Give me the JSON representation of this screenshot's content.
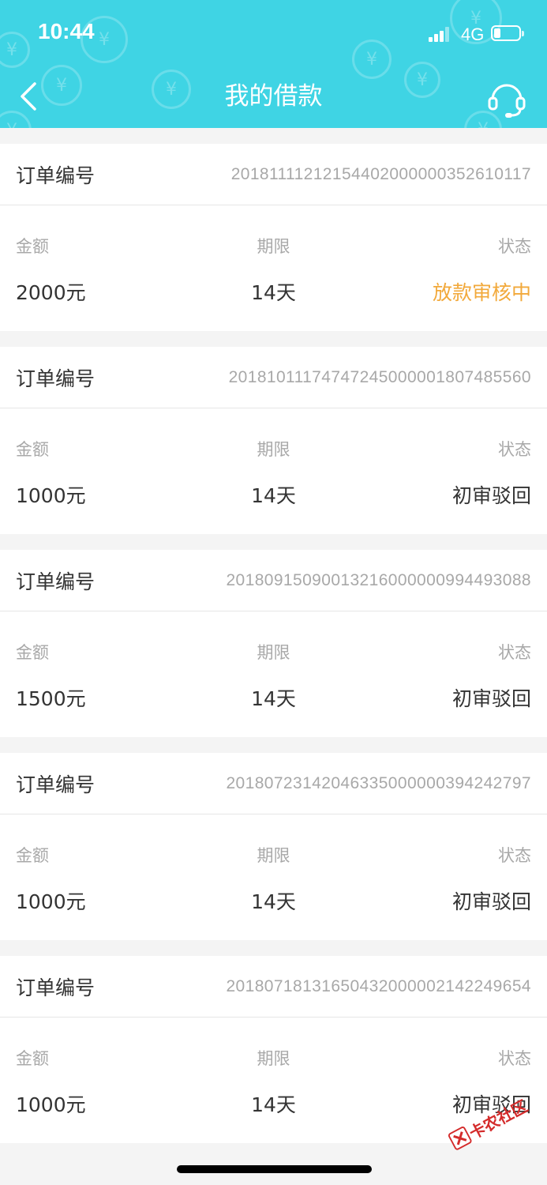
{
  "status_bar": {
    "time": "10:44",
    "network": "4G",
    "battery_level": 0.25
  },
  "nav": {
    "title": "我的借款",
    "back_icon": "chevron-left-icon",
    "support_icon": "headset-icon"
  },
  "colors": {
    "header": "#3fd4e4",
    "status_pending": "#f2a93b",
    "text_primary": "#333333",
    "text_secondary": "#a8a8a8"
  },
  "labels": {
    "order_no": "订单编号",
    "amount": "金额",
    "term": "期限",
    "status": "状态"
  },
  "orders": [
    {
      "order_no": "20181111212154402000000352610117",
      "amount": "2000元",
      "term": "14天",
      "status": "放款审核中",
      "status_type": "pending"
    },
    {
      "order_no": "20181011174747245000001807485560",
      "amount": "1000元",
      "term": "14天",
      "status": "初审驳回",
      "status_type": "rejected"
    },
    {
      "order_no": "20180915090013216000000994493088",
      "amount": "1500元",
      "term": "14天",
      "status": "初审驳回",
      "status_type": "rejected"
    },
    {
      "order_no": "20180723142046335000000394242797",
      "amount": "1000元",
      "term": "14天",
      "status": "初审驳回",
      "status_type": "rejected"
    },
    {
      "order_no": "20180718131650432000002142249654",
      "amount": "1000元",
      "term": "14天",
      "status": "初审驳回",
      "status_type": "rejected"
    }
  ],
  "watermark": {
    "text": "卡农社区"
  }
}
